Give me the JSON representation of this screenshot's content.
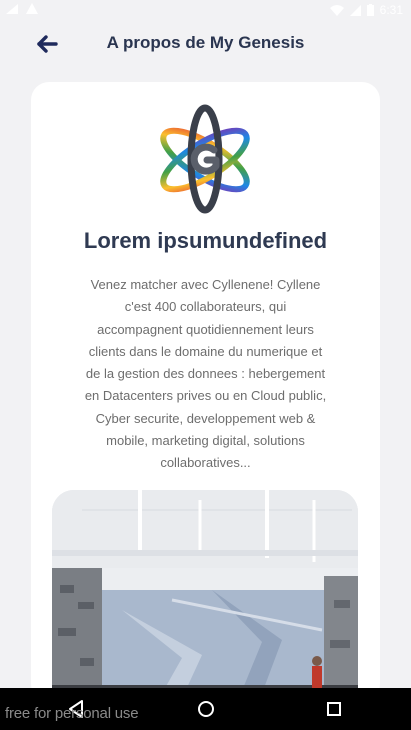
{
  "status_bar": {
    "time": "6:31"
  },
  "header": {
    "title": "A propos de My Genesis",
    "back_icon": "arrow-left-icon"
  },
  "card": {
    "title": "Lorem ipsumundefined",
    "description": "Venez matcher avec Cyllenene! Cyllene c'est 400 collaborateurs, qui accompagnent quotidiennement leurs clients dans le domaine du numerique et de la gestion des donnees : hebergement en Datacenters prives ou en Cloud public, Cyber securite, developpement web & mobile, marketing digital, solutions collaboratives..."
  },
  "nav_bar": {
    "back_icon": "triangle-back-icon",
    "home_icon": "circle-home-icon",
    "recents_icon": "square-recents-icon"
  },
  "watermark": "free for personal use",
  "colors": {
    "title": "#2a3550",
    "background": "#f2f2f4",
    "card": "#ffffff"
  }
}
